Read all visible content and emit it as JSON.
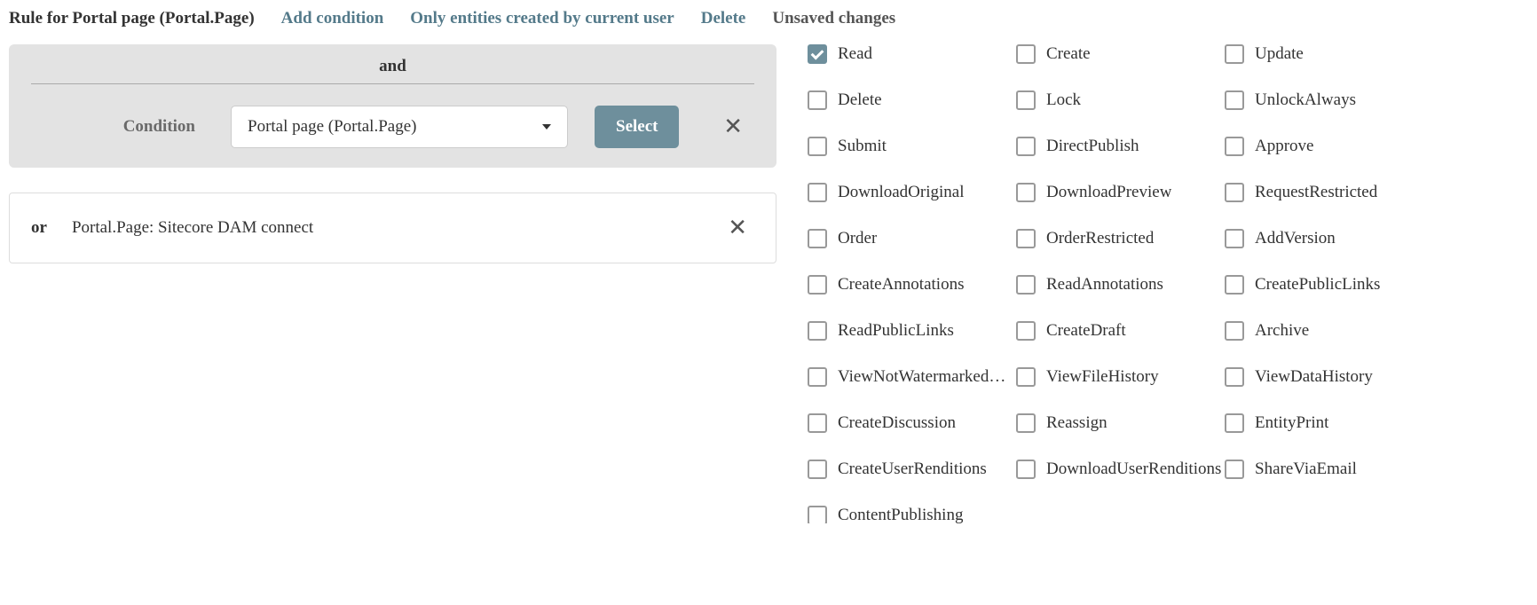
{
  "header": {
    "title": "Rule for Portal page (Portal.Page)",
    "add_condition": "Add condition",
    "only_current_user": "Only entities created by current user",
    "delete": "Delete",
    "unsaved": "Unsaved changes"
  },
  "and_block": {
    "heading": "and",
    "condition_label": "Condition",
    "condition_value": "Portal page (Portal.Page)",
    "select_label": "Select"
  },
  "or_block": {
    "or_label": "or",
    "text": "Portal.Page: Sitecore DAM connect"
  },
  "permissions": [
    {
      "label": "Read",
      "checked": true
    },
    {
      "label": "Create",
      "checked": false
    },
    {
      "label": "Update",
      "checked": false
    },
    {
      "label": "Delete",
      "checked": false
    },
    {
      "label": "Lock",
      "checked": false
    },
    {
      "label": "UnlockAlways",
      "checked": false
    },
    {
      "label": "Submit",
      "checked": false
    },
    {
      "label": "DirectPublish",
      "checked": false
    },
    {
      "label": "Approve",
      "checked": false
    },
    {
      "label": "DownloadOriginal",
      "checked": false
    },
    {
      "label": "DownloadPreview",
      "checked": false
    },
    {
      "label": "RequestRestricted",
      "checked": false
    },
    {
      "label": "Order",
      "checked": false
    },
    {
      "label": "OrderRestricted",
      "checked": false
    },
    {
      "label": "AddVersion",
      "checked": false
    },
    {
      "label": "CreateAnnotations",
      "checked": false
    },
    {
      "label": "ReadAnnotations",
      "checked": false
    },
    {
      "label": "CreatePublicLinks",
      "checked": false
    },
    {
      "label": "ReadPublicLinks",
      "checked": false
    },
    {
      "label": "CreateDraft",
      "checked": false
    },
    {
      "label": "Archive",
      "checked": false
    },
    {
      "label": "ViewNotWatermarkedRenditions",
      "checked": false
    },
    {
      "label": "ViewFileHistory",
      "checked": false
    },
    {
      "label": "ViewDataHistory",
      "checked": false
    },
    {
      "label": "CreateDiscussion",
      "checked": false
    },
    {
      "label": "Reassign",
      "checked": false
    },
    {
      "label": "EntityPrint",
      "checked": false
    },
    {
      "label": "CreateUserRenditions",
      "checked": false
    },
    {
      "label": "DownloadUserRenditions",
      "checked": false
    },
    {
      "label": "ShareViaEmail",
      "checked": false
    },
    {
      "label": "ContentPublishing",
      "checked": false
    }
  ]
}
